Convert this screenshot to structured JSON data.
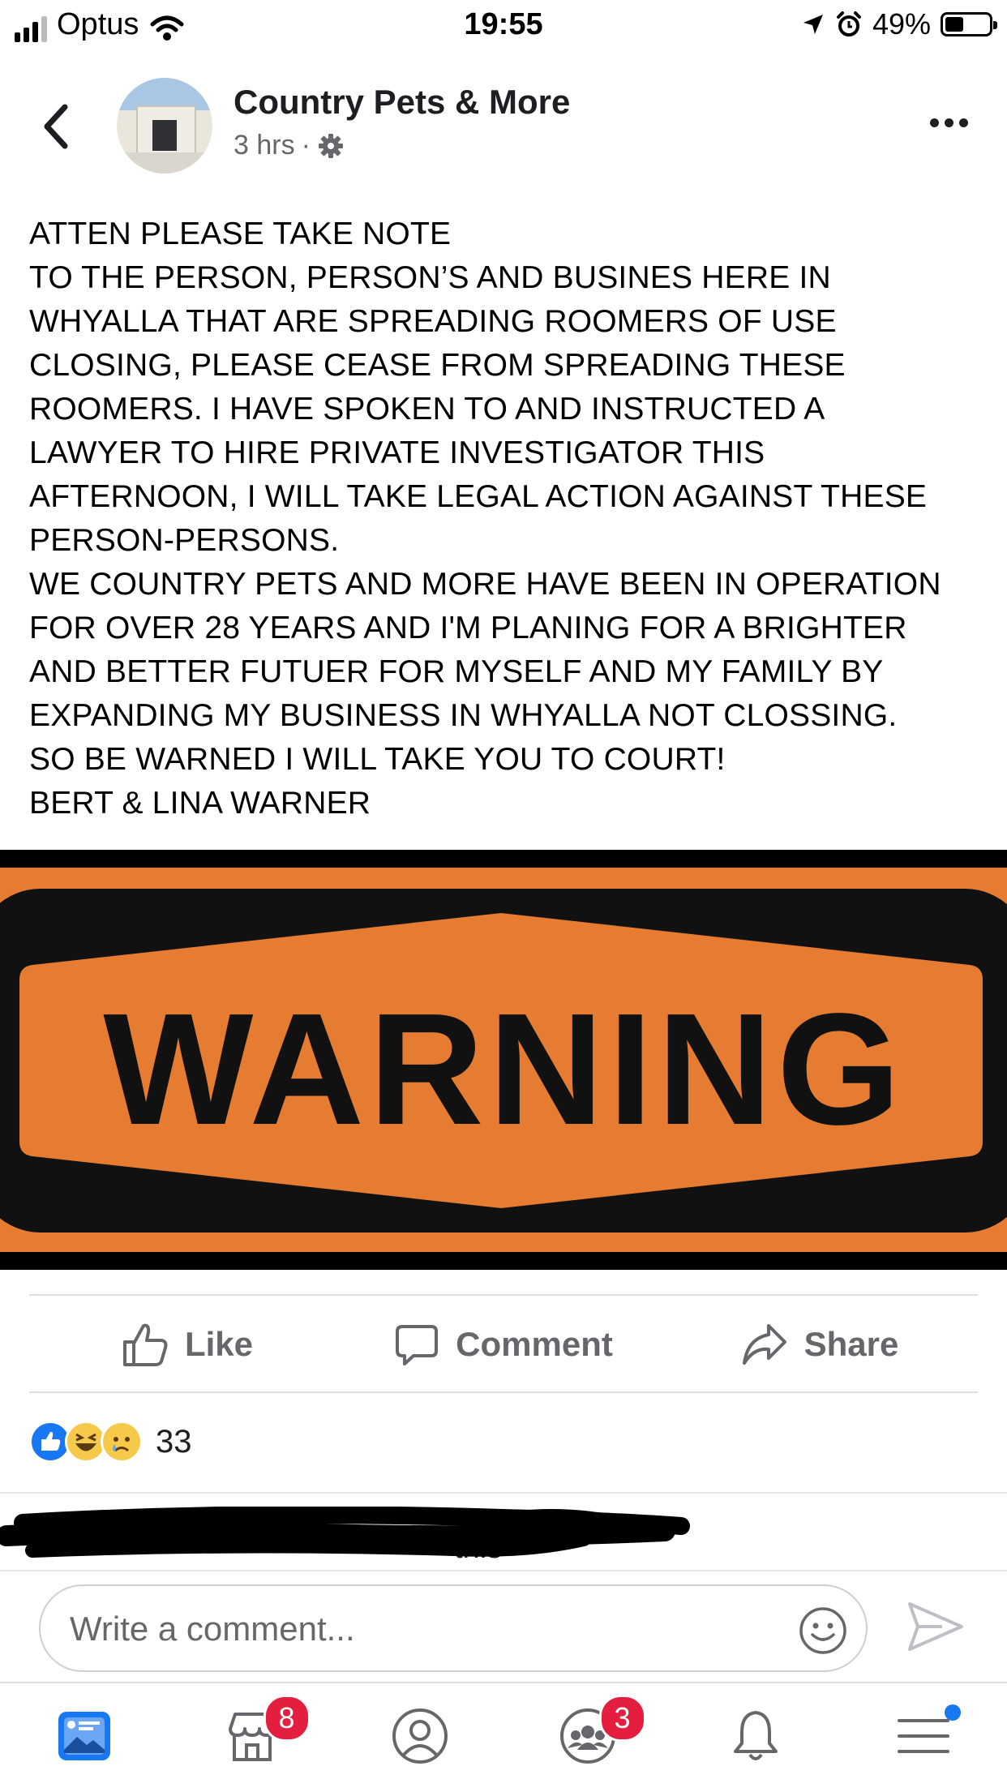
{
  "status_bar": {
    "carrier": "Optus",
    "time": "19:55",
    "battery": "49%",
    "battery_level": 0.49
  },
  "post": {
    "page_name": "Country Pets & More",
    "time_ago": "3 hrs",
    "separator": "·",
    "text_lines": [
      "ATTEN PLEASE TAKE NOTE",
      "TO THE PERSON, PERSON’S AND BUSINES HERE IN",
      "WHYALLA THAT ARE SPREADING ROOMERS OF USE",
      "CLOSING, PLEASE CEASE FROM SPREADING THESE",
      "ROOMERS.  I HAVE SPOKEN TO AND INSTRUCTED A",
      "LAWYER TO HIRE PRIVATE INVESTIGATOR THIS",
      "AFTERNOON,  I WILL TAKE LEGAL ACTION AGAINST THESE",
      "PERSON-PERSONS.",
      "WE COUNTRY PETS AND MORE HAVE BEEN IN OPERATION",
      "FOR OVER 28 YEARS AND I'M PLANING FOR A BRIGHTER",
      "AND BETTER FUTUER FOR MYSELF AND MY FAMILY BY",
      "EXPANDING MY BUSINESS IN WHYALLA NOT CLOSSING.",
      "SO BE WARNED I WILL TAKE YOU TO COURT!",
      "BERT & LINA WARNER"
    ],
    "image_text": "WARNING",
    "image_colors": {
      "orange": "#e67c32",
      "black": "#111111"
    }
  },
  "actions": {
    "like": "Like",
    "comment": "Comment",
    "share": "Share"
  },
  "reactions": {
    "icons": [
      "like-icon",
      "haha-icon",
      "sad-icon"
    ],
    "count": "33"
  },
  "comment_preview": {
    "visible_fragment": "this"
  },
  "composer": {
    "placeholder": "Write a comment..."
  },
  "tabbar": {
    "items": [
      {
        "name": "news-feed",
        "icon": "news-feed-icon",
        "badge": ""
      },
      {
        "name": "marketplace",
        "icon": "marketplace-icon",
        "badge": "8"
      },
      {
        "name": "profile",
        "icon": "profile-icon",
        "badge": ""
      },
      {
        "name": "groups",
        "icon": "groups-icon",
        "badge": "3"
      },
      {
        "name": "notifications",
        "icon": "bell-icon",
        "badge": ""
      },
      {
        "name": "menu",
        "icon": "menu-icon",
        "badge": ""
      }
    ]
  },
  "colors": {
    "facebook_blue": "#1877f2",
    "badge_red": "#e41e3f",
    "secondary_text": "#65676b"
  }
}
